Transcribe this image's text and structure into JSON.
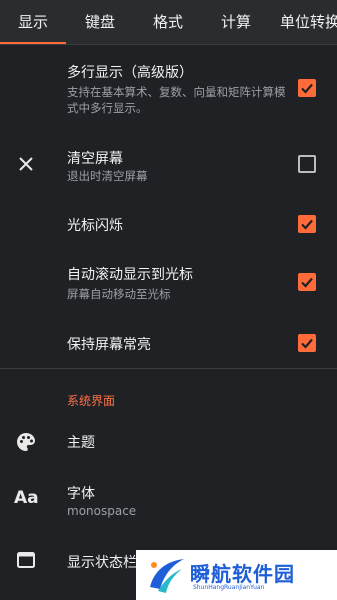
{
  "tabs": [
    {
      "label": "显示",
      "active": true
    },
    {
      "label": "键盘",
      "active": false
    },
    {
      "label": "格式",
      "active": false
    },
    {
      "label": "计算",
      "active": false
    },
    {
      "label": "单位转换",
      "active": false
    }
  ],
  "settings": [
    {
      "title": "多行显示（高级版）",
      "subtitle": "支持在基本算术、复数、向量和矩阵计算模式中多行显示。",
      "checked": true,
      "icon": ""
    },
    {
      "title": "清空屏幕",
      "subtitle": "退出时清空屏幕",
      "checked": false,
      "icon": "close-icon"
    },
    {
      "title": "光标闪烁",
      "subtitle": "",
      "checked": true,
      "icon": ""
    },
    {
      "title": "自动滚动显示到光标",
      "subtitle": "屏幕自动移动至光标",
      "checked": true,
      "icon": ""
    },
    {
      "title": "保持屏幕常亮",
      "subtitle": "",
      "checked": true,
      "icon": ""
    }
  ],
  "section": {
    "header": "系统界面",
    "items": [
      {
        "title": "主题",
        "subtitle": "",
        "icon": "palette-icon"
      },
      {
        "title": "字体",
        "subtitle": "monospace",
        "icon": "font-icon",
        "icon_text": "Aa"
      },
      {
        "title": "显示状态栏",
        "subtitle": "",
        "icon": "window-icon"
      }
    ]
  },
  "watermark": {
    "text": "瞬航软件园",
    "sub": "ShunHangRuanJianYuan"
  },
  "colors": {
    "accent": "#ff6c3a",
    "background": "#1f2125",
    "tabbar": "#2a2c30"
  }
}
